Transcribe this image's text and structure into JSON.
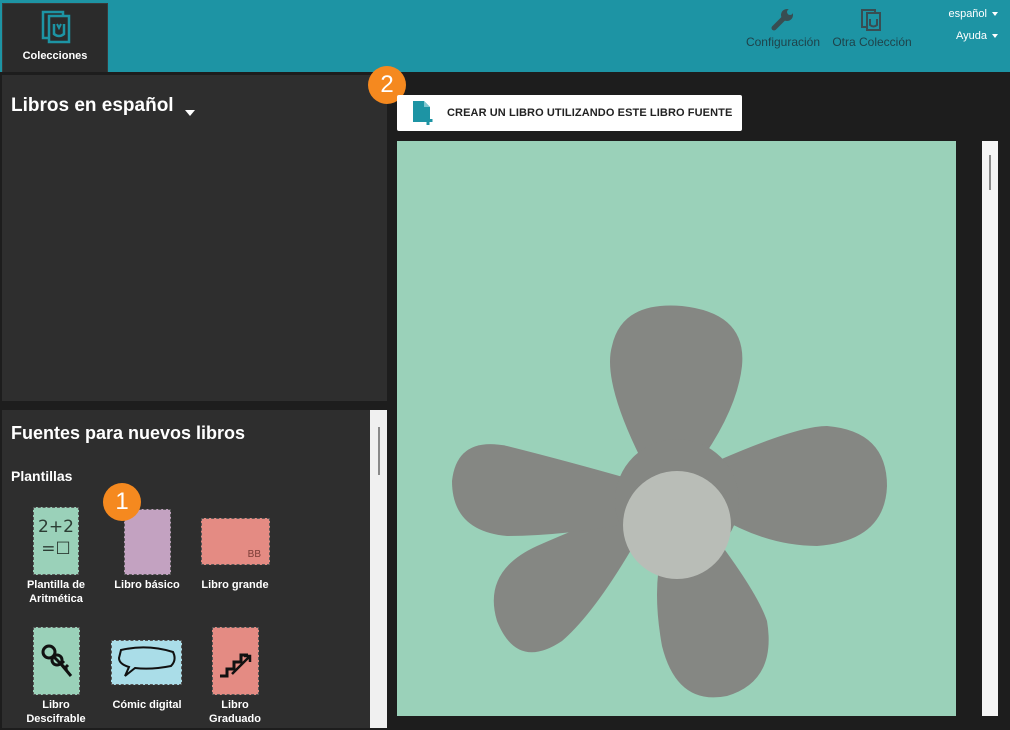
{
  "topbar": {
    "collections_tab": "Colecciones",
    "settings_label": "Configuración",
    "other_collection_label": "Otra Colección",
    "language": "español",
    "help": "Ayuda"
  },
  "collection": {
    "title": "Libros en español"
  },
  "sources": {
    "title": "Fuentes para nuevos libros",
    "templates_heading": "Plantillas",
    "templates": [
      {
        "label": "Plantilla de Aritmética",
        "thumb_text_1": "2+2",
        "thumb_text_2": "=☐",
        "color": "#9ad1b9"
      },
      {
        "label": "Libro básico",
        "color": "#c3a2c1"
      },
      {
        "label": "Libro grande",
        "thumb_text": "BB",
        "color": "#e48b83"
      },
      {
        "label": "Libro Descifrable",
        "color": "#9ad1b9"
      },
      {
        "label": "Cómic digital",
        "color": "#aadde8"
      },
      {
        "label": "Libro Graduado",
        "color": "#e48b83"
      }
    ]
  },
  "badges": {
    "one": "1",
    "two": "2"
  },
  "main": {
    "create_button": "CREAR UN LIBRO UTILIZANDO ESTE LIBRO FUENTE"
  },
  "colors": {
    "topbar": "#1d94a4",
    "panel": "#2e2e2e",
    "badge": "#f5891f",
    "preview_bg": "#9ad1b9",
    "flower": "#858783",
    "flower_center": "#b9bdb7"
  }
}
